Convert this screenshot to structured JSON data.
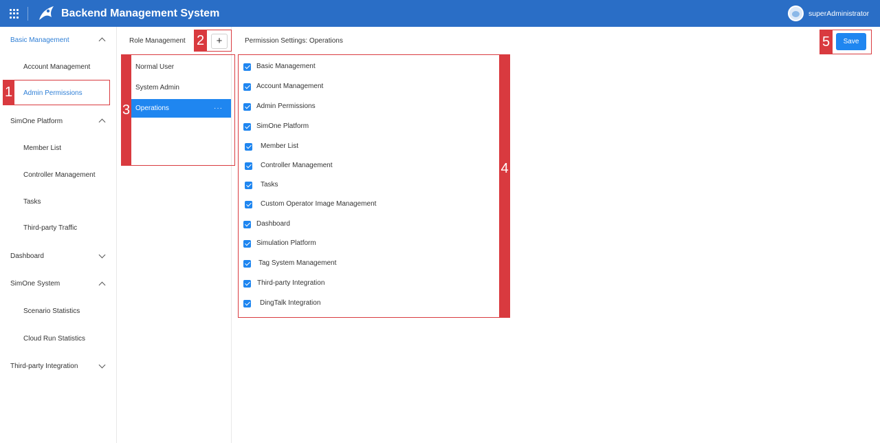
{
  "header": {
    "title": "Backend Management System",
    "user": "superAdministrator",
    "brand_color": "#2a6ec6"
  },
  "sidebar": {
    "groups": [
      {
        "label": "Basic Management",
        "expanded": true,
        "active": true,
        "items": [
          {
            "label": "Account Management"
          },
          {
            "label": "Admin Permissions",
            "active": true
          }
        ]
      },
      {
        "label": "SimOne Platform",
        "expanded": true,
        "items": [
          {
            "label": "Member List"
          },
          {
            "label": "Controller Management"
          },
          {
            "label": "Tasks"
          },
          {
            "label": "Third-party Traffic"
          }
        ]
      },
      {
        "label": "Dashboard",
        "expanded": false,
        "items": []
      },
      {
        "label": "SimOne System",
        "expanded": true,
        "items": [
          {
            "label": "Scenario Statistics"
          },
          {
            "label": "Cloud Run Statistics"
          }
        ]
      },
      {
        "label": "Third-party Integration",
        "expanded": false,
        "items": []
      }
    ]
  },
  "roles": {
    "title": "Role Management",
    "add_label": "+",
    "items": [
      {
        "label": "Normal User"
      },
      {
        "label": "System Admin"
      },
      {
        "label": "Operations",
        "selected": true,
        "more": "···"
      }
    ]
  },
  "permissions": {
    "title": "Permission Settings: Operations",
    "save_label": "Save",
    "items": [
      {
        "label": "Basic Management",
        "checked": true
      },
      {
        "label": "Account Management",
        "checked": true
      },
      {
        "label": "Admin Permissions",
        "checked": true
      },
      {
        "label": "SimOne Platform",
        "checked": true
      },
      {
        "label": "Member List",
        "checked": true
      },
      {
        "label": "Controller Management",
        "checked": true
      },
      {
        "label": "Tasks",
        "checked": true
      },
      {
        "label": "Custom Operator Image Management",
        "checked": true
      },
      {
        "label": "Dashboard",
        "checked": true
      },
      {
        "label": "Simulation Platform",
        "checked": true
      },
      {
        "label": "Tag System Management",
        "checked": true
      },
      {
        "label": "Third-party Integration",
        "checked": true
      },
      {
        "label": "DingTalk Integration",
        "checked": true
      }
    ]
  },
  "annotations": [
    {
      "label": "1"
    },
    {
      "label": "2"
    },
    {
      "label": "3"
    },
    {
      "label": "4"
    },
    {
      "label": "5"
    }
  ],
  "colors": {
    "accent": "#1f86f0",
    "annotation": "#d93a3f"
  }
}
